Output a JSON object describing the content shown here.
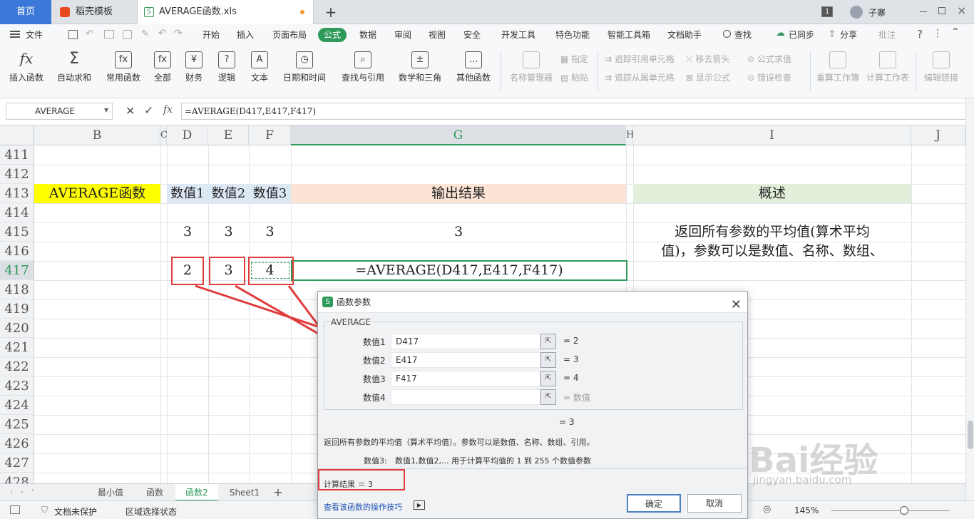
{
  "tabs": {
    "home": "首页",
    "template": "稻壳模板",
    "file": "AVERAGE函数.xls",
    "add": "+"
  },
  "window": {
    "badge": "1",
    "user": "子寨"
  },
  "menus": [
    "文件",
    "开始",
    "插入",
    "页面布局",
    "公式",
    "数据",
    "审阅",
    "视图",
    "安全",
    "开发工具",
    "特色功能",
    "智能工具箱",
    "文档助手",
    "查找",
    "已同步",
    "分享",
    "批注"
  ],
  "ribbon": {
    "buttons": [
      {
        "label": "插入函数",
        "icon": "fx-icon",
        "glyph": "fx"
      },
      {
        "label": "自动求和",
        "icon": "sigma-icon",
        "glyph": "Σ"
      },
      {
        "label": "常用函数",
        "icon": "star-fx-icon",
        "glyph": "fx"
      },
      {
        "label": "全部",
        "icon": "fx-all-icon",
        "glyph": "fx"
      },
      {
        "label": "财务",
        "icon": "finance-icon",
        "glyph": "¥"
      },
      {
        "label": "逻辑",
        "icon": "logic-icon",
        "glyph": "?"
      },
      {
        "label": "文本",
        "icon": "text-icon",
        "glyph": "A"
      },
      {
        "label": "日期和时间",
        "icon": "clock-icon",
        "glyph": "◷"
      },
      {
        "label": "查找与引用",
        "icon": "lookup-icon",
        "glyph": "⌕"
      },
      {
        "label": "数学和三角",
        "icon": "math-icon",
        "glyph": "±"
      },
      {
        "label": "其他函数",
        "icon": "more-fx-icon",
        "glyph": "…"
      }
    ],
    "name_manager": "名称管理器",
    "define": "指定",
    "paste": "粘贴",
    "trace_precedents": "追踪引用单元格",
    "trace_dependents": "追踪从属单元格",
    "remove_arrows": "移去箭头",
    "show_formulas": "显示公式",
    "evaluate": "公式求值",
    "error_check": "错误检查",
    "recalc_book": "重算工作簿",
    "calc_sheet": "计算工作表",
    "edit_links": "编辑链接"
  },
  "formula_bar": {
    "name_box": "AVERAGE",
    "fx": "fx",
    "formula": "=AVERAGE(D417,E417,F417)"
  },
  "columns": [
    "B",
    "C",
    "D",
    "E",
    "F",
    "G",
    "H",
    "I",
    "J"
  ],
  "rows": [
    "411",
    "412",
    "413",
    "414",
    "415",
    "416",
    "417",
    "418",
    "419",
    "420",
    "421",
    "422",
    "423",
    "424",
    "425",
    "426",
    "427",
    "428"
  ],
  "cells": {
    "b413": "AVERAGE函数",
    "d413": "数值1",
    "e413": "数值2",
    "f413": "数值3",
    "g413": "输出结果",
    "i413": "概述",
    "d415": "3",
    "e415": "3",
    "f415": "3",
    "g415": "3",
    "i415": "返回所有参数的平均值(算术平均",
    "i416": "值)，参数可以是数值、名称、数组、",
    "d417": "2",
    "e417": "3",
    "f417": "4",
    "g417": "=AVERAGE(D417,E417,F417)"
  },
  "colors": {
    "yellow": "#ffff00",
    "blue_light": "#dde8f5",
    "peach": "#fbe4d6",
    "green_light": "#e2efda",
    "accent_green": "#2f9a5a",
    "red": "#e03c3c"
  },
  "sheet_tabs": [
    "最小值",
    "函数",
    "函数2",
    "Sheet1",
    "+"
  ],
  "status": {
    "doc_protect": "文档未保护",
    "region": "区域选择状态",
    "zoom": "145%"
  },
  "dialog": {
    "title": "函数参数",
    "func": "AVERAGE",
    "args": [
      {
        "label": "数值1",
        "value": "D417",
        "result": "= 2"
      },
      {
        "label": "数值2",
        "value": "E417",
        "result": "= 3"
      },
      {
        "label": "数值3",
        "value": "F417",
        "result": "= 4"
      },
      {
        "label": "数值4",
        "value": "",
        "result": "= 数值"
      }
    ],
    "total": "= 3",
    "description": "返回所有参数的平均值（算术平均值）。参数可以是数值、名称、数组、引用。",
    "arg_help_label": "数值3:",
    "arg_help": "数值1,数值2,... 用于计算平均值的 1 到 255 个数值参数",
    "calc_result": "计算结果 ＝ 3",
    "help_link": "查看该函数的操作技巧",
    "ok": "确定",
    "cancel": "取消"
  },
  "watermark": {
    "brand": "Bai经验",
    "url": "jingyan.baidu.com"
  }
}
